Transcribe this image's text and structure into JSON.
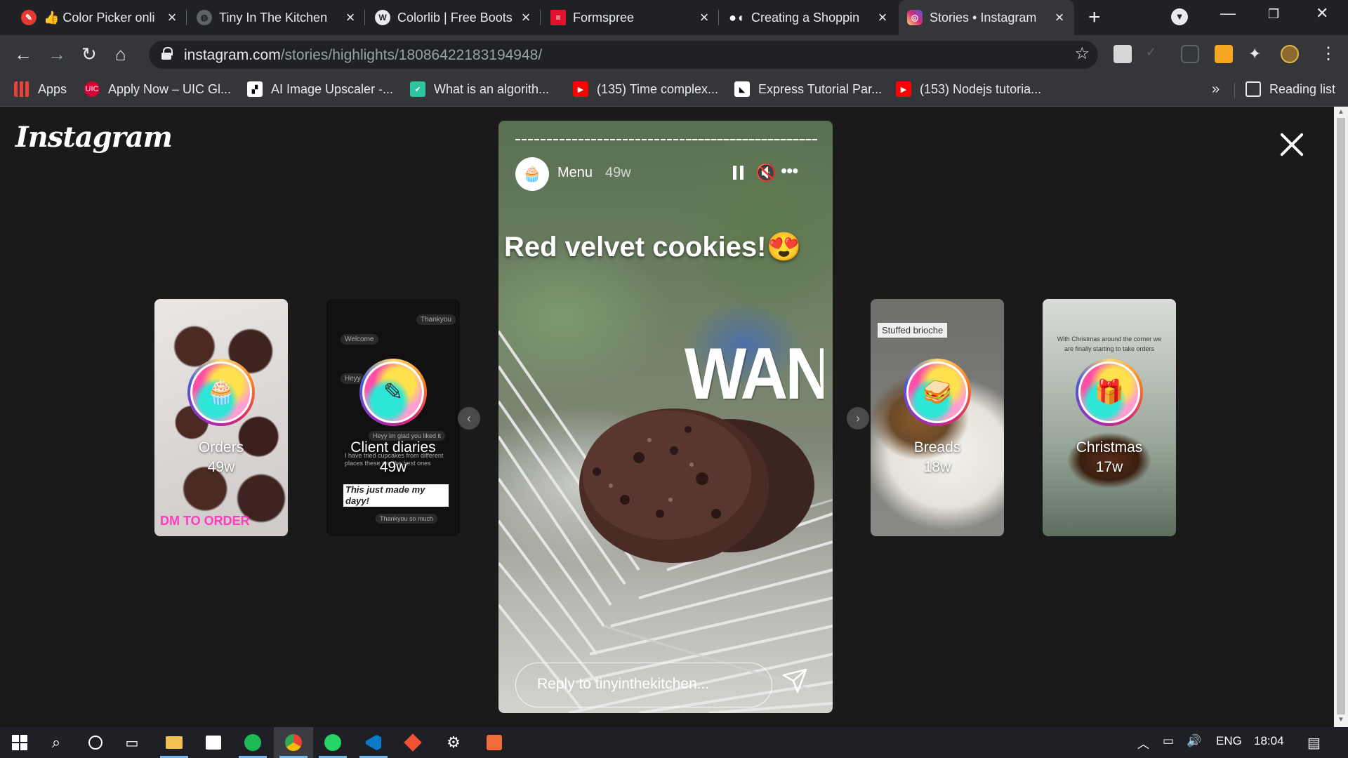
{
  "browser": {
    "tabs": [
      {
        "title": "👍 Color Picker onli",
        "icon": "color-picker-favicon"
      },
      {
        "title": "Tiny In The Kitchen",
        "icon": "globe-favicon"
      },
      {
        "title": "Colorlib | Free Boots",
        "icon": "wordpress-favicon"
      },
      {
        "title": "Formspree",
        "icon": "formspree-favicon"
      },
      {
        "title": "Creating a Shoppin",
        "icon": "medium-favicon"
      },
      {
        "title": "Stories • Instagram",
        "icon": "instagram-favicon",
        "active": true
      }
    ],
    "url_host": "instagram.com",
    "url_path": "/stories/highlights/18086422183194948/",
    "bookmarks": [
      {
        "label": "Apps",
        "icon": "apps-grid-icon"
      },
      {
        "label": "Apply Now – UIC Gl...",
        "icon": "uic-icon"
      },
      {
        "label": "AI Image Upscaler -...",
        "icon": "upscaler-icon"
      },
      {
        "label": "What is an algorith...",
        "icon": "shield-icon"
      },
      {
        "label": "(135) Time complex...",
        "icon": "youtube-icon"
      },
      {
        "label": "Express Tutorial Par...",
        "icon": "mdn-icon"
      },
      {
        "label": "(153) Nodejs tutoria...",
        "icon": "youtube-icon"
      }
    ],
    "more_bookmarks": "»",
    "reading_list": "Reading list"
  },
  "viewer": {
    "logo": "Instagram",
    "highlights_left": [
      {
        "name": "Orders",
        "age": "49w",
        "caption": "DM TO ORDER",
        "icon": "cupcake-icon"
      },
      {
        "name": "Client diaries",
        "age": "49w",
        "caption": "This just made my dayy!",
        "icon": "journal-icon"
      }
    ],
    "highlights_right": [
      {
        "name": "Breads",
        "age": "18w",
        "caption": "Stuffed brioche",
        "icon": "sandwich-icon"
      },
      {
        "name": "Christmas",
        "age": "17w",
        "caption": "With Christmas around the corner we are finally starting to take orders",
        "icon": "gifts-icon"
      }
    ],
    "chat_snippets": [
      "Thankyou",
      "Welcome",
      "Heyy",
      "Heyy im glad you liked it",
      "I have tried cupcakes from different places these are the best ones",
      "Thankyou so much"
    ],
    "story": {
      "username": "Menu",
      "age": "49w",
      "headline": "Red velvet cookies!😍",
      "sticker": "WANT",
      "reply_placeholder": "Reply to tinyinthekitchen...",
      "progress": 0.57
    }
  },
  "taskbar": {
    "language": "ENG",
    "time": "18:04"
  },
  "colors": {
    "tab_strip": "#202124",
    "toolbar": "#35363a",
    "viewer_bg": "#1a1a1a",
    "taskbar": "#1f2025",
    "accent_taskbar": "#76b9ed"
  }
}
